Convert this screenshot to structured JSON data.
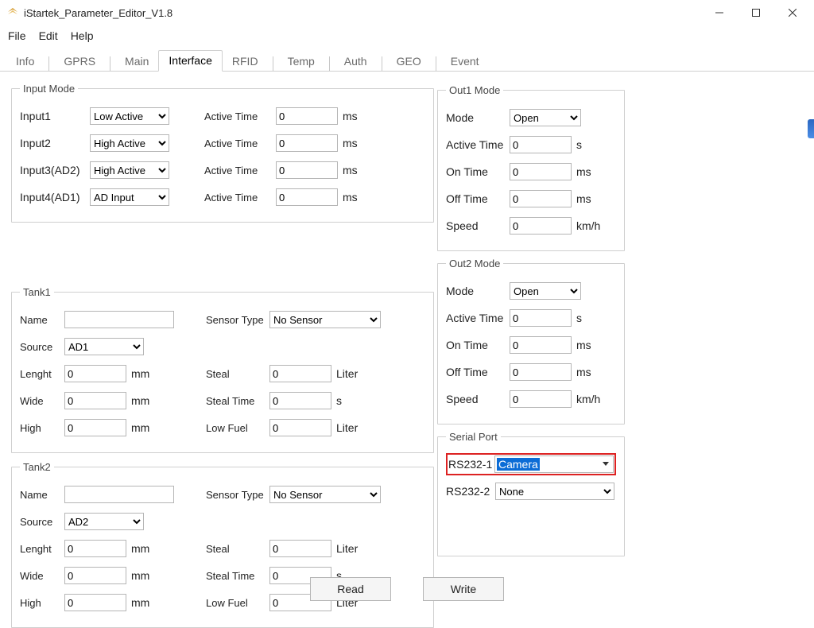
{
  "window": {
    "title": "iStartek_Parameter_Editor_V1.8"
  },
  "menu": {
    "file": "File",
    "edit": "Edit",
    "help": "Help"
  },
  "tabs": [
    "Info",
    "GPRS",
    "Main",
    "Interface",
    "RFID",
    "Temp",
    "Auth",
    "GEO",
    "Event"
  ],
  "active_tab": 3,
  "input_mode": {
    "legend": "Input Mode",
    "rows": [
      {
        "label": "Input1",
        "mode": "Low Active",
        "at_label": "Active Time",
        "val": "0",
        "unit": "ms"
      },
      {
        "label": "Input2",
        "mode": "High Active",
        "at_label": "Active Time",
        "val": "0",
        "unit": "ms"
      },
      {
        "label": "Input3(AD2)",
        "mode": "High Active",
        "at_label": "Active Time",
        "val": "0",
        "unit": "ms"
      },
      {
        "label": "Input4(AD1)",
        "mode": "AD Input",
        "at_label": "Active Time",
        "val": "0",
        "unit": "ms"
      }
    ]
  },
  "tank1": {
    "legend": "Tank1",
    "name_lbl": "Name",
    "name": "",
    "src_lbl": "Source",
    "src": "AD1",
    "len_lbl": "Lenght",
    "len": "0",
    "len_u": "mm",
    "wid_lbl": "Wide",
    "wid": "0",
    "wid_u": "mm",
    "high_lbl": "High",
    "high": "0",
    "high_u": "mm",
    "st_lbl": "Sensor Type",
    "st": "No Sensor",
    "steal_lbl": "Steal",
    "steal": "0",
    "steal_u": "Liter",
    "stime_lbl": "Steal Time",
    "stime": "0",
    "stime_u": "s",
    "low_lbl": "Low Fuel",
    "low": "0",
    "low_u": "Liter"
  },
  "tank2": {
    "legend": "Tank2",
    "name_lbl": "Name",
    "name": "",
    "src_lbl": "Source",
    "src": "AD2",
    "len_lbl": "Lenght",
    "len": "0",
    "len_u": "mm",
    "wid_lbl": "Wide",
    "wid": "0",
    "wid_u": "mm",
    "high_lbl": "High",
    "high": "0",
    "high_u": "mm",
    "st_lbl": "Sensor Type",
    "st": "No Sensor",
    "steal_lbl": "Steal",
    "steal": "0",
    "steal_u": "Liter",
    "stime_lbl": "Steal Time",
    "stime": "0",
    "stime_u": "s",
    "low_lbl": "Low Fuel",
    "low": "0",
    "low_u": "Liter"
  },
  "out1": {
    "legend": "Out1 Mode",
    "rows": [
      {
        "lbl": "Mode",
        "type": "select",
        "val": "Open",
        "unit": ""
      },
      {
        "lbl": "Active Time",
        "type": "text",
        "val": "0",
        "unit": "s"
      },
      {
        "lbl": "On Time",
        "type": "text",
        "val": "0",
        "unit": "ms"
      },
      {
        "lbl": "Off Time",
        "type": "text",
        "val": "0",
        "unit": "ms"
      },
      {
        "lbl": "Speed",
        "type": "text",
        "val": "0",
        "unit": "km/h"
      }
    ]
  },
  "out2": {
    "legend": "Out2 Mode",
    "rows": [
      {
        "lbl": "Mode",
        "type": "select",
        "val": "Open",
        "unit": ""
      },
      {
        "lbl": "Active Time",
        "type": "text",
        "val": "0",
        "unit": "s"
      },
      {
        "lbl": "On Time",
        "type": "text",
        "val": "0",
        "unit": "ms"
      },
      {
        "lbl": "Off Time",
        "type": "text",
        "val": "0",
        "unit": "ms"
      },
      {
        "lbl": "Speed",
        "type": "text",
        "val": "0",
        "unit": "km/h"
      }
    ]
  },
  "serial": {
    "legend": "Serial Port",
    "r1_lbl": "RS232-1",
    "r1_val": "Camera",
    "r2_lbl": "RS232-2",
    "r2_val": "None"
  },
  "buttons": {
    "read": "Read",
    "write": "Write"
  }
}
